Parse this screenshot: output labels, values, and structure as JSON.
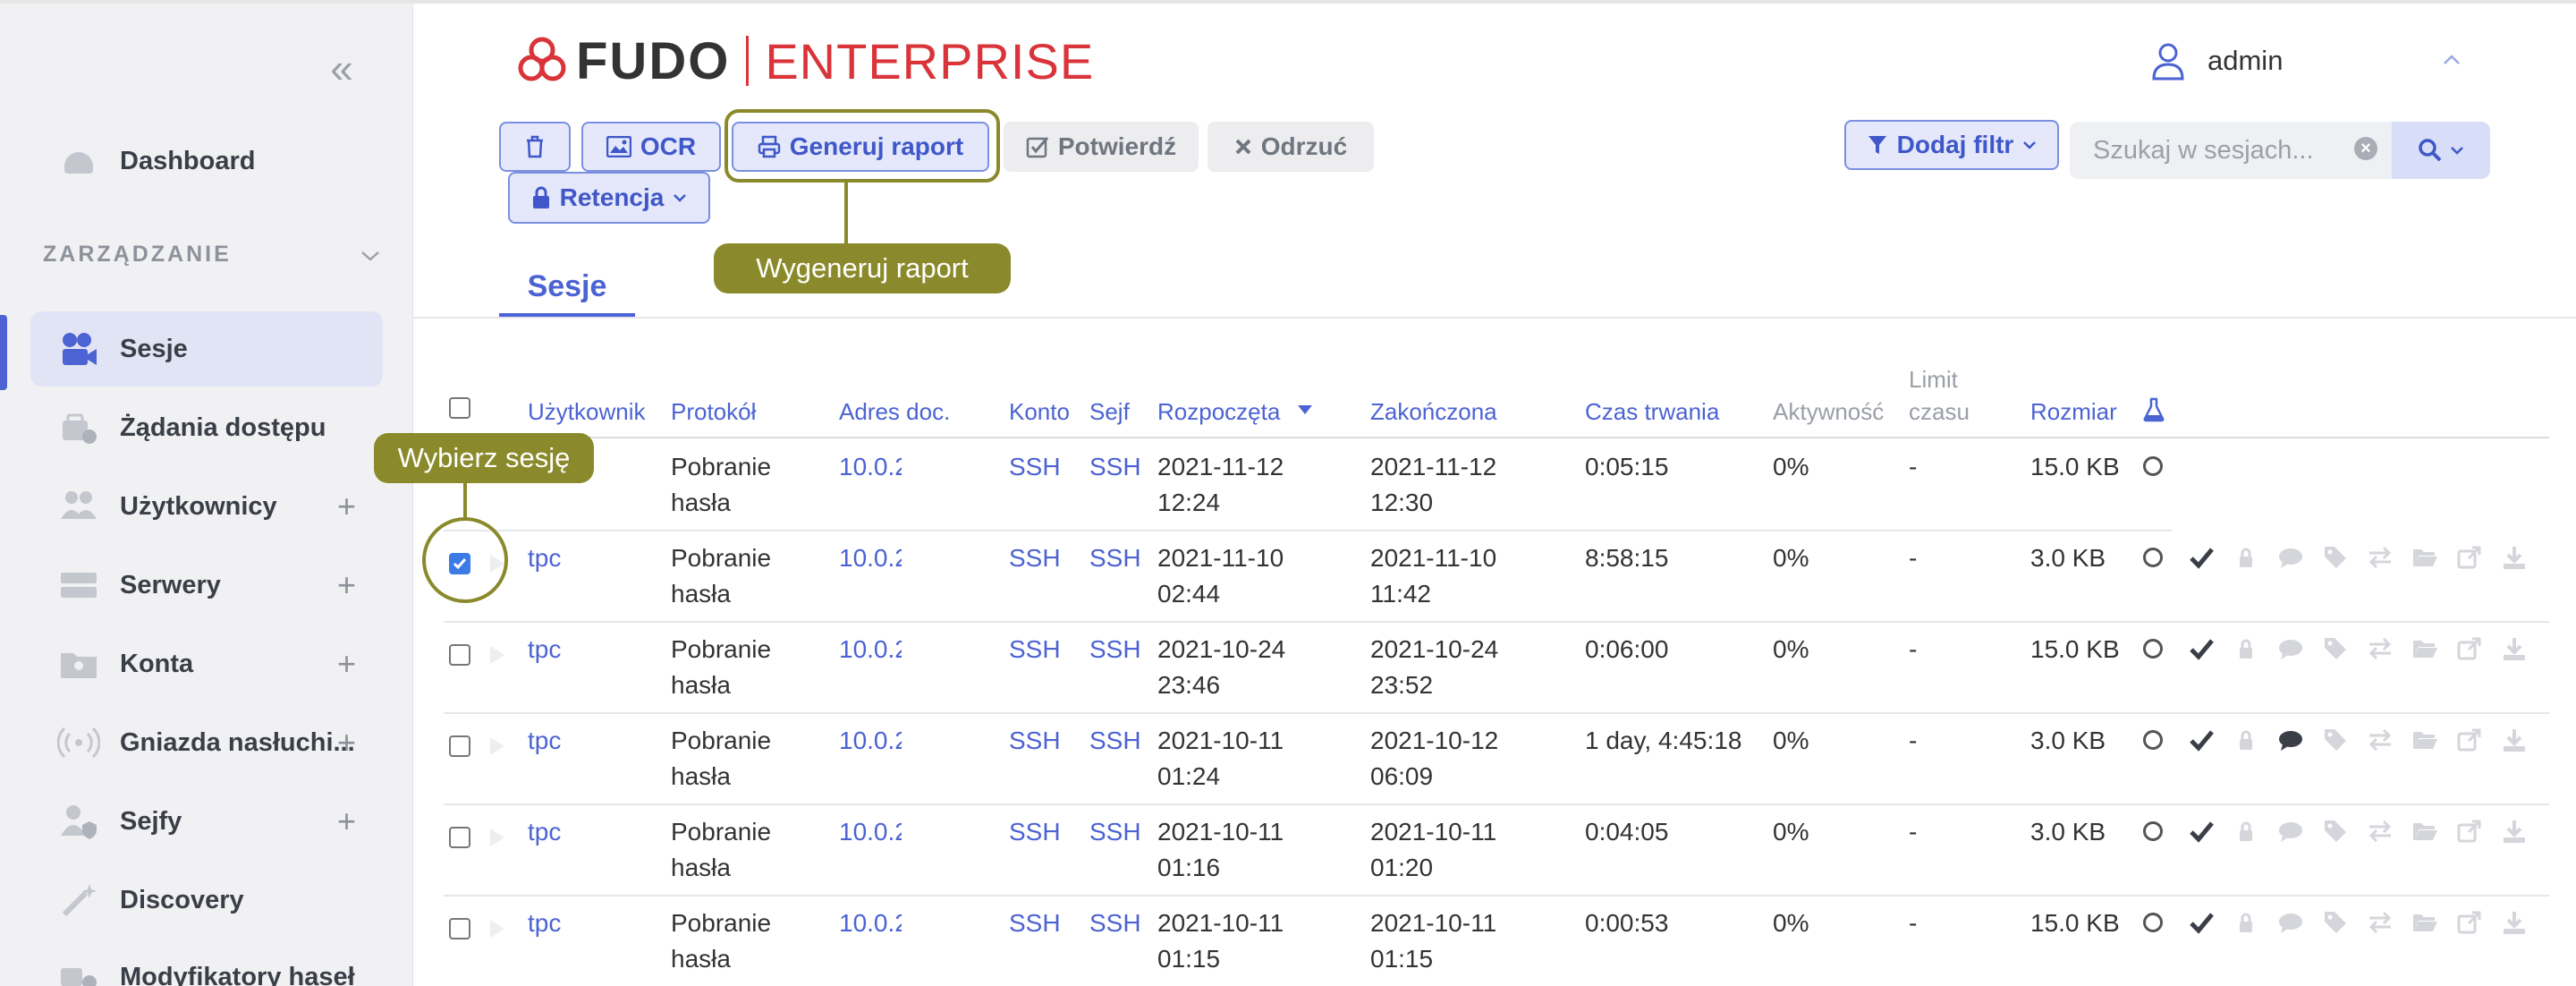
{
  "sidebar": {
    "collapse": "«",
    "section": "ZARZĄDZANIE",
    "items": [
      {
        "label": "Dashboard",
        "icon": "dashboard-icon"
      },
      {
        "label": "Sesje",
        "icon": "sessions-icon",
        "active": true
      },
      {
        "label": "Żądania dostępu",
        "icon": "access-requests-icon"
      },
      {
        "label": "Użytkownicy",
        "icon": "users-icon",
        "plus": "+"
      },
      {
        "label": "Serwery",
        "icon": "servers-icon",
        "plus": "+"
      },
      {
        "label": "Konta",
        "icon": "accounts-icon",
        "plus": "+"
      },
      {
        "label": "Gniazda nasłuchi...",
        "icon": "listeners-icon",
        "plus": "+"
      },
      {
        "label": "Sejfy",
        "icon": "safes-icon",
        "plus": "+"
      },
      {
        "label": "Discovery",
        "icon": "discovery-icon"
      },
      {
        "label": "Modyfikatory haseł",
        "icon": "password-modifiers-icon"
      }
    ]
  },
  "header": {
    "brand": "FUDO",
    "edition": "ENTERPRISE",
    "user": "admin"
  },
  "toolbar": {
    "ocr": "OCR",
    "report": "Generuj raport",
    "confirm": "Potwierdź",
    "reject": "Odrzuć",
    "retention": "Retencja",
    "filter": "Dodaj filtr",
    "search_placeholder": "Szukaj w sesjach..."
  },
  "callouts": {
    "report": "Wygeneruj raport",
    "select": "Wybierz sesję"
  },
  "tabs": [
    "Sesje"
  ],
  "table": {
    "headers": {
      "user": "Użytkownik",
      "protocol": "Protokół",
      "address": "Adres doc.",
      "account": "Konto",
      "safe": "Sejf",
      "started": "Rozpoczęta",
      "ended": "Zakończona",
      "duration": "Czas trwania",
      "activity": "Aktywność",
      "limit1": "Limit",
      "limit2": "czasu",
      "size": "Rozmiar"
    },
    "rows": [
      {
        "user": "",
        "proto1": "Pobranie",
        "proto2": "hasła",
        "address": "10.0.2",
        "account": "SSH",
        "safe": "SSH",
        "start1": "2021-11-12",
        "start2": "12:24",
        "end1": "2021-11-12",
        "end2": "12:30",
        "duration": "0:05:15",
        "activity": "0%",
        "limit": "-",
        "size": "15.0 KB",
        "checked": false
      },
      {
        "user": "tpc",
        "proto1": "Pobranie",
        "proto2": "hasła",
        "address": "10.0.2",
        "account": "SSH",
        "safe": "SSH",
        "start1": "2021-11-10",
        "start2": "02:44",
        "end1": "2021-11-10",
        "end2": "11:42",
        "duration": "8:58:15",
        "activity": "0%",
        "limit": "-",
        "size": "3.0 KB",
        "checked": true
      },
      {
        "user": "tpc",
        "proto1": "Pobranie",
        "proto2": "hasła",
        "address": "10.0.2",
        "account": "SSH",
        "safe": "SSH",
        "start1": "2021-10-24",
        "start2": "23:46",
        "end1": "2021-10-24",
        "end2": "23:52",
        "duration": "0:06:00",
        "activity": "0%",
        "limit": "-",
        "size": "15.0 KB",
        "checked": false
      },
      {
        "user": "tpc",
        "proto1": "Pobranie",
        "proto2": "hasła",
        "address": "10.0.2",
        "account": "SSH",
        "safe": "SSH",
        "start1": "2021-10-11",
        "start2": "01:24",
        "end1": "2021-10-12",
        "end2": "06:09",
        "duration": "1 day, 4:45:18",
        "activity": "0%",
        "limit": "-",
        "size": "3.0 KB",
        "checked": false,
        "comment": true
      },
      {
        "user": "tpc",
        "proto1": "Pobranie",
        "proto2": "hasła",
        "address": "10.0.2",
        "account": "SSH",
        "safe": "SSH",
        "start1": "2021-10-11",
        "start2": "01:16",
        "end1": "2021-10-11",
        "end2": "01:20",
        "duration": "0:04:05",
        "activity": "0%",
        "limit": "-",
        "size": "3.0 KB",
        "checked": false
      },
      {
        "user": "tpc",
        "proto1": "Pobranie",
        "proto2": "hasła",
        "address": "10.0.2",
        "account": "SSH",
        "safe": "SSH",
        "start1": "2021-10-11",
        "start2": "01:15",
        "end1": "2021-10-11",
        "end2": "01:15",
        "duration": "0:00:53",
        "activity": "0%",
        "limit": "-",
        "size": "15.0 KB",
        "checked": false
      }
    ]
  },
  "colors": {
    "accent": "#4b63d3",
    "brand_red": "#d9343a",
    "callout": "#8a8a2c"
  }
}
